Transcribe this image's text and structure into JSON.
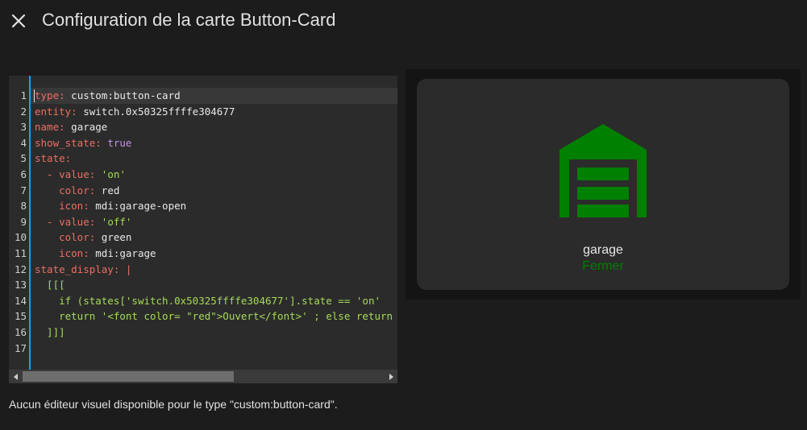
{
  "dialog": {
    "title": "Configuration de la carte Button-Card",
    "close_icon": "close-icon"
  },
  "editor": {
    "line_numbers": [
      "1",
      "2",
      "3",
      "4",
      "5",
      "6",
      "7",
      "8",
      "9",
      "10",
      "11",
      "12",
      "13",
      "14",
      "15",
      "16",
      "17"
    ],
    "lines": [
      {
        "key": "type:",
        "val": " custom:button-card"
      },
      {
        "key": "entity:",
        "val": " switch.0x50325ffffe304677"
      },
      {
        "key": "name:",
        "val": " garage"
      },
      {
        "key": "show_state:",
        "val": " true"
      },
      {
        "key": "state:",
        "val": ""
      },
      {
        "key": "  - value:",
        "val": " 'on'"
      },
      {
        "key": "    color:",
        "val": " red"
      },
      {
        "key": "    icon:",
        "val": " mdi:garage-open"
      },
      {
        "key": "  - value:",
        "val": " 'off'"
      },
      {
        "key": "    color:",
        "val": " green"
      },
      {
        "key": "    icon:",
        "val": " mdi:garage"
      },
      {
        "key": "state_display:",
        "val": " |"
      },
      {
        "key": "",
        "val": "  [[["
      },
      {
        "key": "",
        "val": "    if (states['switch.0x50325ffffe304677'].state == 'on'"
      },
      {
        "key": "",
        "val": "    return '<font color= \"red\">Ouvert</font>' ; else return"
      },
      {
        "key": "",
        "val": "  ]]]"
      },
      {
        "key": "",
        "val": ""
      }
    ]
  },
  "footnote": "Aucun éditeur visuel disponible pour le type \"custom:button-card\".",
  "preview": {
    "name": "garage",
    "state": "Fermer",
    "icon": "garage-icon",
    "state_color": "#008000"
  },
  "colors": {
    "background": "#1c1c1c",
    "accent": "#03a9f4",
    "icon_green": "#008000"
  }
}
